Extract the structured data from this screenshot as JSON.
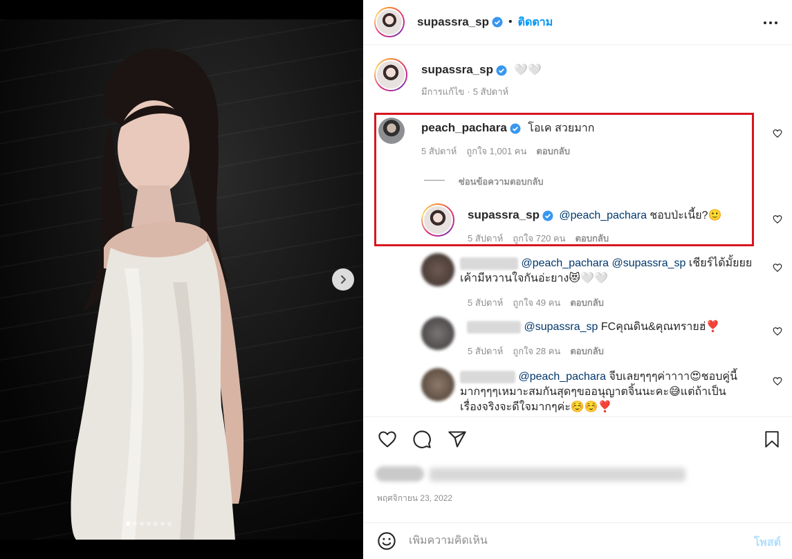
{
  "post": {
    "author": "supassra_sp",
    "follow_label": "ติดตาม",
    "caption_text": "🤍🤍",
    "caption_meta_edited": "มีการแก้ไข",
    "caption_meta_time": "5 สัปดาห์",
    "date": "พฤศจิกายน 23, 2022"
  },
  "carousel": {
    "dot_count": 7,
    "active_index": 0
  },
  "comments": [
    {
      "username": "peach_pachara",
      "verified": true,
      "text": "โอเค สวยมาก",
      "time": "5 สัปดาห์",
      "likes": "ถูกใจ 1,001 คน",
      "reply_label": "ตอบกลับ",
      "hide_replies_label": "ซ่อนข้อความตอบกลับ",
      "reply": {
        "username": "supassra_sp",
        "mention": "@peach_pachara",
        "text": " ชอบป่ะเนี้ย?🙂",
        "time": "5 สัปดาห์",
        "likes": "ถูกใจ 720 คน",
        "reply_label": "ตอบกลับ"
      }
    },
    {
      "mention": "@peach_pachara @supassra_sp",
      "text": " เชียร์ได้มั้ยยย",
      "text_line2": "เค้ามีหวานใจกันอ่ะยาง😻🤍🤍",
      "time": "5 สัปดาห์",
      "likes": "ถูกใจ 49 คน",
      "reply_label": "ตอบกลับ"
    },
    {
      "mention": "@supassra_sp",
      "text": " FCคุณดิน&คุณทรายฮ่❣️",
      "time": "5 สัปดาห์",
      "likes": "ถูกใจ 28 คน",
      "reply_label": "ตอบกลับ"
    },
    {
      "mention": "@peach_pachara",
      "text": " จีบเลยๆๆๆค่าาาา😍ชอบคู่นี้",
      "text_line2": "มากๆๆๆเหมาะสมกันสุดๆขออนุญาตจิ้นนะคะ😅แต่ถ้าเป็น",
      "text_line3": "เรื่องจริงจะดีใจมากๆค่ะ☺️☺️❣️"
    }
  ],
  "comment_bar": {
    "placeholder": "เพิ่มความคิดเห็น",
    "post_label": "โพสต์"
  },
  "colors": {
    "accent": "#0095f6",
    "highlight_border": "#d7141e",
    "muted": "#8e8e8e"
  },
  "icons": [
    "more-options-icon",
    "verified-badge-icon",
    "heart-icon",
    "comment-icon",
    "share-icon",
    "bookmark-icon",
    "emoji-icon",
    "chevron-right-icon"
  ]
}
